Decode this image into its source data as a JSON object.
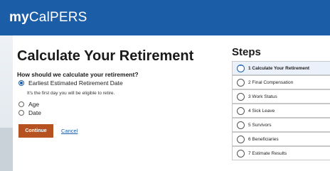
{
  "header": {
    "logo_bold": "my",
    "logo_rest": "CalPERS"
  },
  "main": {
    "title": "Calculate Your Retirement",
    "question": "How should we calculate your retirement?",
    "options": [
      {
        "label": "Earliest Estimated Retirement Date",
        "selected": true
      },
      {
        "label": "Age",
        "selected": false
      },
      {
        "label": "Date",
        "selected": false
      }
    ],
    "hint": "It's the first day you will be eligible to retire.",
    "continue_label": "Continue",
    "cancel_label": "Cancel"
  },
  "steps": {
    "title": "Steps",
    "items": [
      {
        "label": "1 Calculate Your Retirement",
        "active": true,
        "icon": "ellipsis"
      },
      {
        "label": "2 Final Compensation",
        "active": false
      },
      {
        "label": "3 Work Status",
        "active": false
      },
      {
        "label": "4 Sick Leave",
        "active": false
      },
      {
        "label": "5 Survivors",
        "active": false
      },
      {
        "label": "6 Beneficiaries",
        "active": false
      },
      {
        "label": "7 Estimate Results",
        "active": false
      }
    ]
  },
  "colors": {
    "header": "#1c5da8",
    "primary_button": "#b5521f",
    "link": "#1c5da8"
  }
}
